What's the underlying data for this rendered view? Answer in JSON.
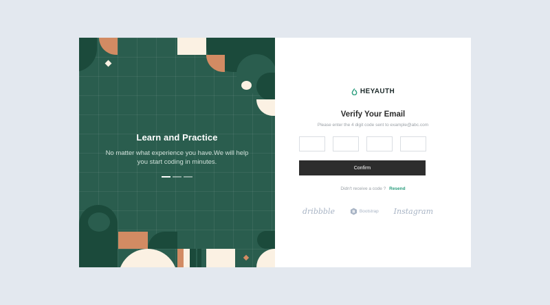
{
  "left_panel": {
    "title": "Learn and Practice",
    "subtitle": "No matter what experience you have.We will help you start coding in minutes."
  },
  "brand": {
    "name": "HEYAUTH"
  },
  "verify": {
    "title": "Verify Your Email",
    "subtitle": "Please enter the 4 digit code sent to example@abc.com"
  },
  "confirm_label": "Confirm",
  "resend": {
    "prompt": "Didn't receive a code ?",
    "link": "Resend"
  },
  "partners": {
    "dribbble": "dribbble",
    "bootstrap": "Bootstrap",
    "instagram": "Instagram"
  },
  "colors": {
    "panel_green": "#2a5d4e",
    "dark_green": "#1b4a3b",
    "terracotta": "#d28b63",
    "cream": "#fbf1e3",
    "accent_teal": "#2a9d7d",
    "button_dark": "#2d2d2d"
  }
}
